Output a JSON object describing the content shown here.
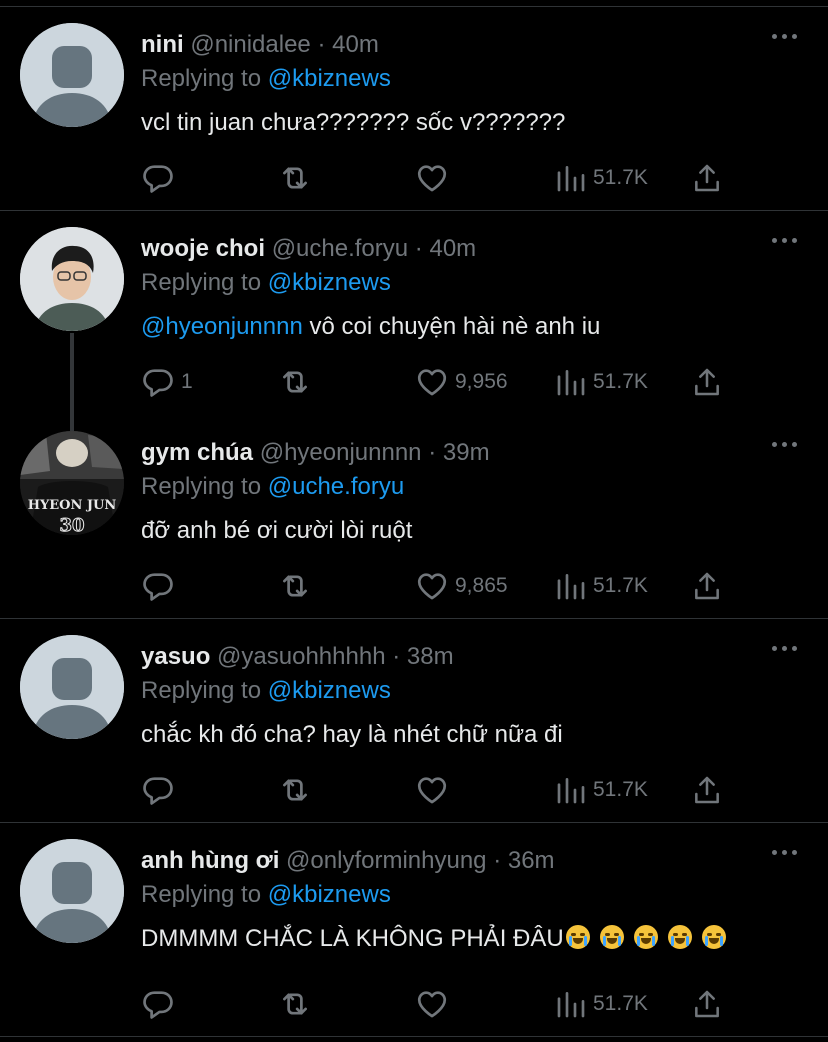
{
  "colors": {
    "background": "#000000",
    "text": "#e7e9ea",
    "muted": "#71767b",
    "link": "#1d9bf0",
    "divider": "#2f3336"
  },
  "tweets": [
    {
      "name": "nini",
      "handle": "@ninidalee",
      "time": "40m",
      "replying_prefix": "Replying to",
      "replying_to": "@kbiznews",
      "text": "vcl tin juan chưa??????? sốc v???????",
      "reply_count": "",
      "like_count": "",
      "views": "51.7K",
      "avatar": "default-avatar"
    },
    {
      "name": "wooje choi",
      "handle": "@uche.foryu",
      "time": "40m",
      "replying_prefix": "Replying to",
      "replying_to": "@kbiznews",
      "text_mention": "@hyeonjunnnn",
      "text": " vô coi chuyện hài nè anh iu",
      "reply_count": "1",
      "like_count": "9,956",
      "views": "51.7K",
      "avatar": "photo-avatar"
    },
    {
      "name": "gym chúa",
      "handle": "@hyeonjunnnn",
      "time": "39m",
      "replying_prefix": "Replying to",
      "replying_to": "@uche.foryu",
      "text": "đỡ anh bé ơi cười lòi ruột",
      "reply_count": "",
      "like_count": "9,865",
      "views": "51.7K",
      "avatar": "photo-avatar",
      "avatar_caption": "HYEON JUN"
    },
    {
      "name": "yasuo",
      "handle": "@yasuohhhhhh",
      "time": "38m",
      "replying_prefix": "Replying to",
      "replying_to": "@kbiznews",
      "text": "chắc kh đó cha? hay là nhét chữ nữa đi",
      "reply_count": "",
      "like_count": "",
      "views": "51.7K",
      "avatar": "default-avatar"
    },
    {
      "name": "anh hùng ơi",
      "handle": "@onlyforminhyung",
      "time": "36m",
      "replying_prefix": "Replying to",
      "replying_to": "@kbiznews",
      "text": "DMMMM CHẮC LÀ KHÔNG PHẢI ĐÂU",
      "text_emoji": "loudly-crying-face",
      "text_emoji_count": 5,
      "reply_count": "",
      "like_count": "",
      "views": "51.7K",
      "avatar": "default-avatar"
    }
  ],
  "icons": {
    "reply": "reply-icon",
    "retweet": "retweet-icon",
    "like": "like-icon",
    "views": "views-icon",
    "share": "share-icon",
    "more": "more-icon"
  }
}
